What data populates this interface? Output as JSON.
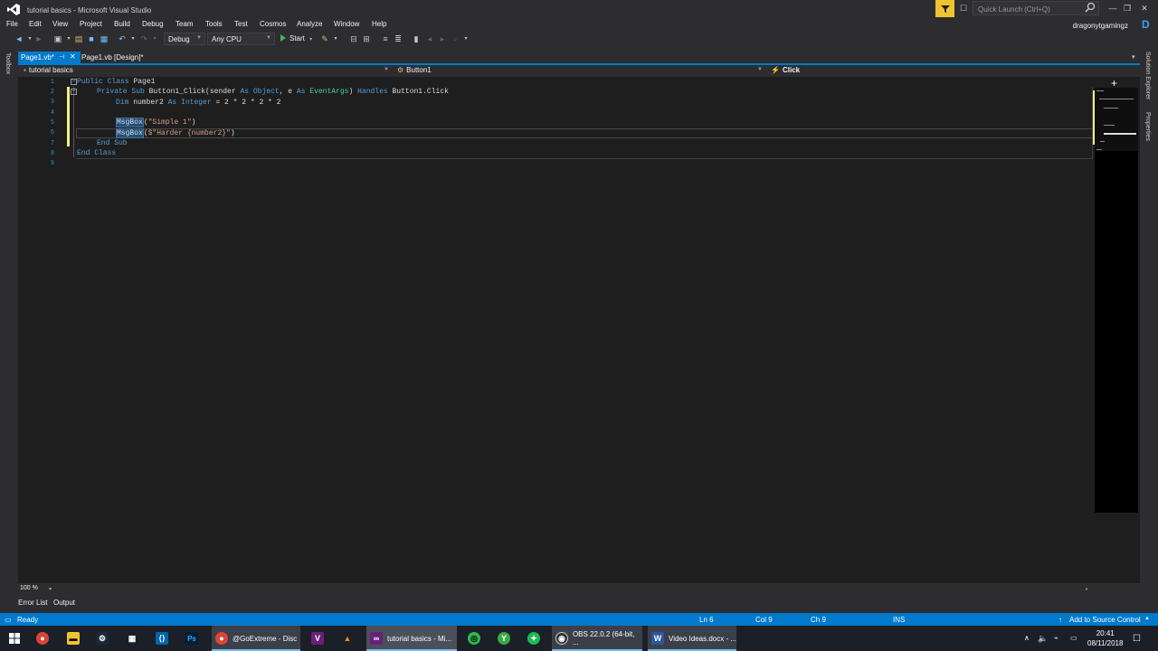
{
  "window": {
    "title": "tutorial basics - Microsoft Visual Studio",
    "quick_launch_placeholder": "Quick Launch (Ctrl+Q)",
    "user": "dragonytgamingz",
    "avatar_letter": "D"
  },
  "menu": [
    "File",
    "Edit",
    "View",
    "Project",
    "Build",
    "Debug",
    "Team",
    "Tools",
    "Test",
    "Cosmos",
    "Analyze",
    "Window",
    "Help"
  ],
  "toolbar": {
    "config": "Debug",
    "platform": "Any CPU",
    "start_label": "Start"
  },
  "side_tabs": {
    "left": "Toolbox",
    "right": [
      "Solution Explorer",
      "Properties"
    ]
  },
  "tabs": [
    {
      "label": "Page1.vb*",
      "active": true
    },
    {
      "label": "Page1.vb [Design]*",
      "active": false
    }
  ],
  "navbar": {
    "project": "tutorial basics",
    "object": "Button1",
    "event": "Click"
  },
  "code": {
    "line_numbers": [
      "1",
      "2",
      "3",
      "4",
      "5",
      "6",
      "7",
      "8",
      "9"
    ],
    "l1_kw": "Public Class",
    "l1_name": " Page1",
    "l2_kw1": "Private Sub",
    "l2_name": " Button1_Click(sender ",
    "l2_as1": "As",
    "l2_obj": " Object",
    "l2_mid": ", e ",
    "l2_as2": "As",
    "l2_ev": " EventArgs",
    "l2_close": ") ",
    "l2_handles": "Handles",
    "l2_end": " Button1.Click",
    "l3_dim": "Dim",
    "l3_var": " number2 ",
    "l3_as": "As",
    "l3_type": " Integer",
    "l3_expr": " = 2 * 2 * 2 * 2",
    "l5_fn": "MsgBox",
    "l5_open": "(",
    "l5_str": "\"Simple 1\"",
    "l5_close": ")",
    "l6_fn": "MsgBox",
    "l6_open": "(",
    "l6_str": "$\"Harder {number2}\"",
    "l6_close": ")",
    "l7": "End Sub",
    "l8": "End Class"
  },
  "editor": {
    "zoom": "100 %"
  },
  "bottom_tabs": [
    "Error List",
    "Output"
  ],
  "status": {
    "state": "Ready",
    "ln": "Ln 6",
    "col": "Col 9",
    "ch": "Ch 9",
    "mode": "INS",
    "source_control": "Add to Source Control"
  },
  "taskbar": {
    "apps": [
      {
        "label": "@GoExtreme - Disc"
      },
      {
        "label": "tutorial basics - Mi..."
      },
      {
        "label": "OBS 22.0.2 (64-bit, ..."
      },
      {
        "label": "Video Ideas.docx - ..."
      }
    ],
    "time": "20:41",
    "date": "08/11/2018"
  },
  "colors": {
    "accent": "#007acc",
    "editor_bg": "#1e1e1e",
    "keyword": "#569cd6",
    "type": "#4ec9b0",
    "string": "#d69d85"
  }
}
